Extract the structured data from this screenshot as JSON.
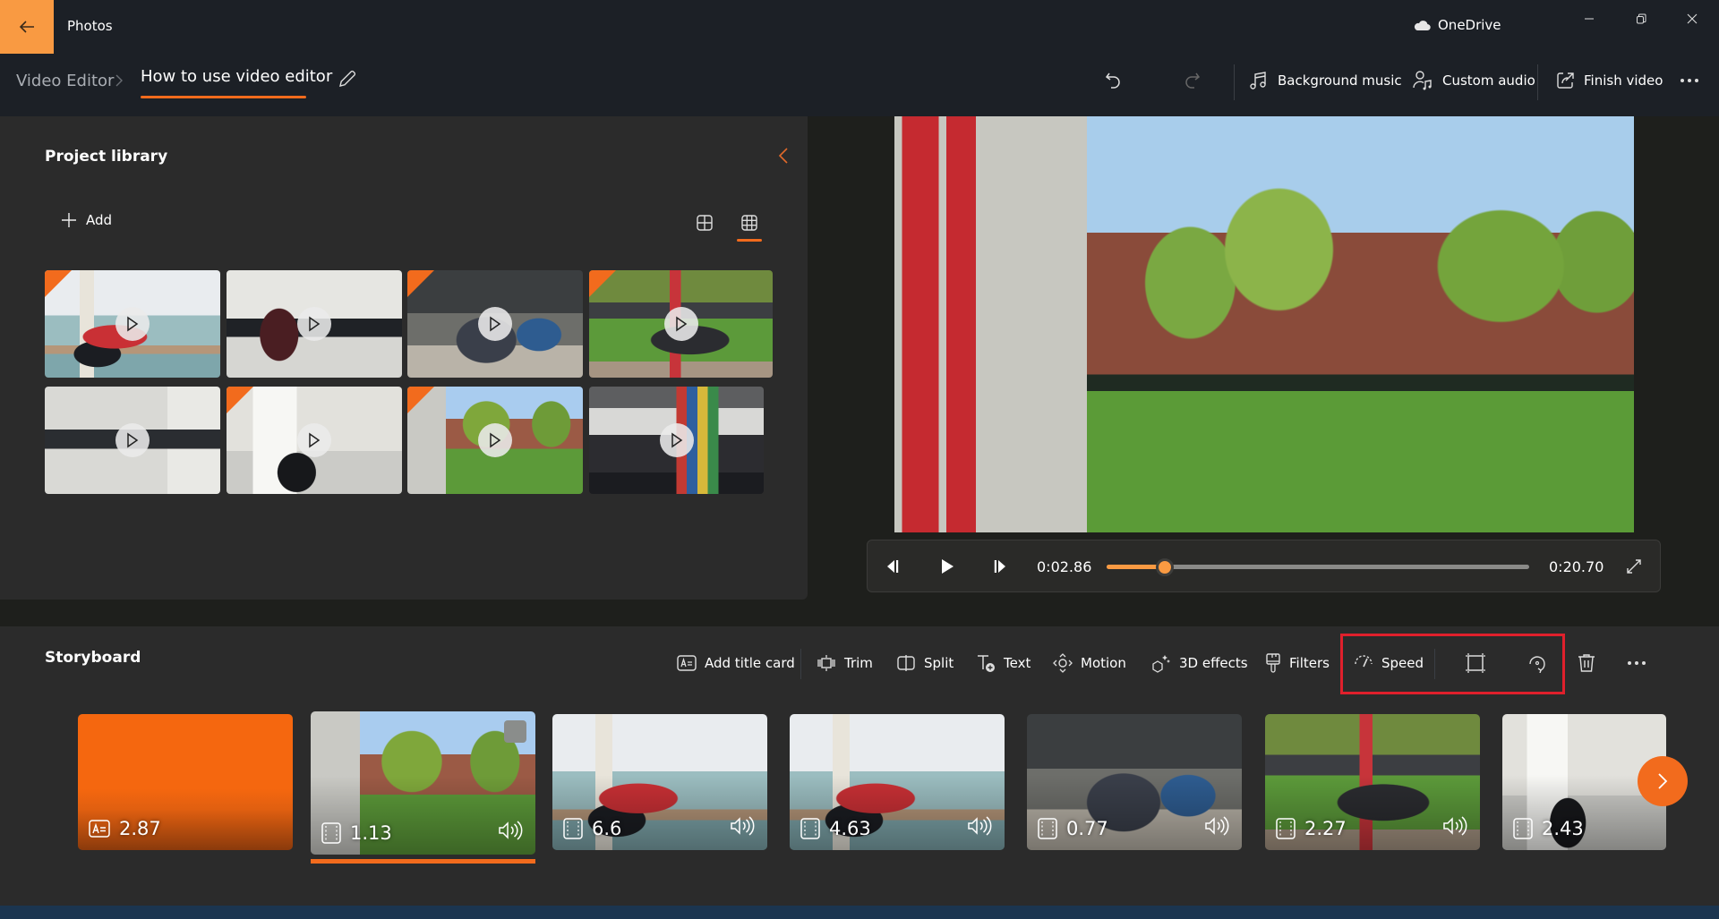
{
  "app": {
    "title": "Photos",
    "onedrive_label": "OneDrive",
    "back_icon": "arrow-left-icon",
    "window_controls": [
      "minimize",
      "restore",
      "close"
    ]
  },
  "breadcrumb": {
    "root": "Video Editor",
    "separator": ">",
    "current": "How to use video editor"
  },
  "command_bar": {
    "undo_label": "Undo",
    "redo_label": "Redo",
    "background_music": "Background music",
    "custom_audio": "Custom audio",
    "finish_video": "Finish video",
    "more_label": "More options"
  },
  "library": {
    "title": "Project library",
    "add_label": "Add",
    "view_modes": [
      "large-grid",
      "small-grid"
    ],
    "active_view": "small-grid",
    "items": [
      {
        "scene": "lounge",
        "in_storyboard": true
      },
      {
        "scene": "computer-lab",
        "in_storyboard": false
      },
      {
        "scene": "patio-tables",
        "in_storyboard": true
      },
      {
        "scene": "lawn-tables",
        "in_storyboard": true
      },
      {
        "scene": "computer-lab-2",
        "in_storyboard": false
      },
      {
        "scene": "computer-lab-3",
        "in_storyboard": true
      },
      {
        "scene": "campus-lawn",
        "in_storyboard": true
      },
      {
        "scene": "atrium",
        "in_storyboard": false
      }
    ]
  },
  "player": {
    "current_time": "0:02.86",
    "total_time": "0:20.70",
    "progress_fraction": 0.138
  },
  "storyboard": {
    "title": "Storyboard",
    "tools": {
      "add_title_card": "Add title card",
      "trim": "Trim",
      "split": "Split",
      "text": "Text",
      "motion": "Motion",
      "effects_3d": "3D effects",
      "filters": "Filters",
      "speed": "Speed",
      "crop_label": "Remove or show black bars",
      "rotate_label": "Rotate",
      "delete_label": "Delete",
      "more_label": "More options"
    },
    "clips": [
      {
        "type": "title-card",
        "duration": "2.87",
        "audio": false,
        "selected": false
      },
      {
        "type": "video",
        "duration": "1.13",
        "audio": true,
        "selected": true
      },
      {
        "type": "video",
        "duration": "6.6",
        "audio": true,
        "selected": false
      },
      {
        "type": "video",
        "duration": "4.63",
        "audio": true,
        "selected": false
      },
      {
        "type": "video",
        "duration": "0.77",
        "audio": true,
        "selected": false
      },
      {
        "type": "video",
        "duration": "2.27",
        "audio": true,
        "selected": false
      },
      {
        "type": "video",
        "duration": "2.43",
        "audio": false,
        "selected": false
      }
    ],
    "next_label": "Next"
  },
  "colors": {
    "accent": "#f26b1d",
    "back_button": "#f99a42",
    "highlight_box": "#e0202c",
    "header_bg": "#1c2026",
    "panel_bg": "#2b2b2b"
  }
}
